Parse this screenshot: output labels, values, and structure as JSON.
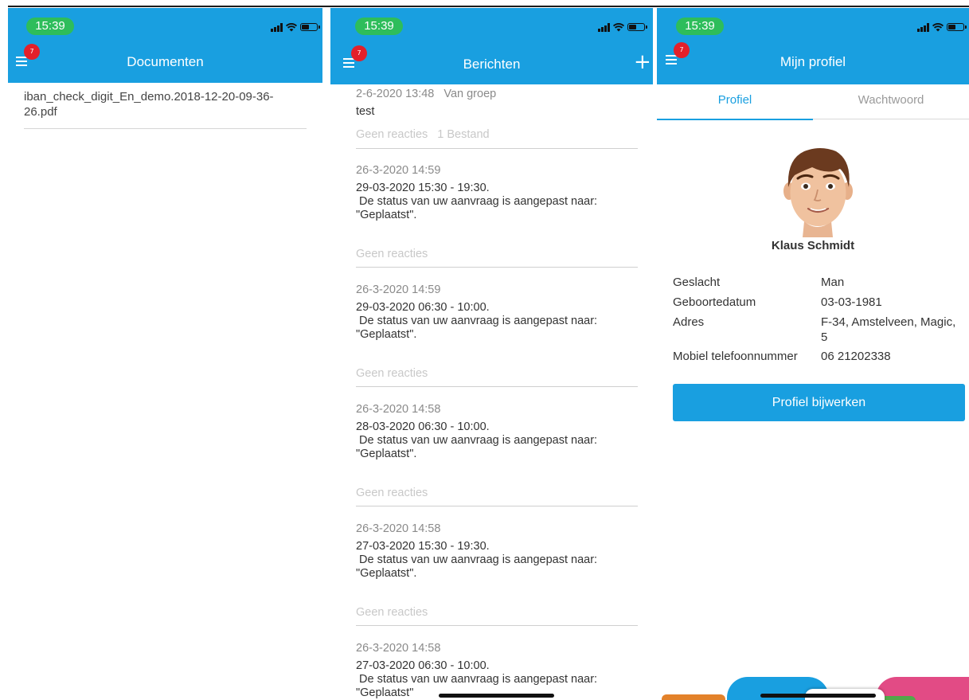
{
  "status_bar": {
    "time": "15:39"
  },
  "colors": {
    "brand_blue": "#199fe0",
    "badge_red": "#e3202a",
    "time_green": "#2ebd5b"
  },
  "icons": [
    "menu-icon",
    "plus-icon",
    "signal-icon",
    "wifi-icon",
    "battery-icon",
    "avatar-icon"
  ],
  "documents": {
    "badge": "7",
    "title": "Documenten",
    "items": [
      {
        "name": "iban_check_digit_En_demo.2018-12-20-09-36-26.pdf"
      }
    ]
  },
  "messages": {
    "badge": "7",
    "title": "Berichten",
    "plus": "+",
    "items": [
      {
        "date": "2-6-2020 13:48",
        "group": "Van groep",
        "line1": "test",
        "line2": "",
        "line3": "",
        "reactions": "Geen reacties",
        "files": "1 Bestand"
      },
      {
        "date": "26-3-2020 14:59",
        "group": "",
        "line1": "29-03-2020 15:30 - 19:30.",
        "line2": " De status van uw aanvraag is aangepast naar:",
        "line3": "\"Geplaatst\".",
        "reactions": "Geen reacties",
        "files": ""
      },
      {
        "date": "26-3-2020 14:59",
        "group": "",
        "line1": "29-03-2020 06:30 - 10:00.",
        "line2": " De status van uw aanvraag is aangepast naar:",
        "line3": "\"Geplaatst\".",
        "reactions": "Geen reacties",
        "files": ""
      },
      {
        "date": "26-3-2020 14:58",
        "group": "",
        "line1": "28-03-2020 06:30 - 10:00.",
        "line2": " De status van uw aanvraag is aangepast naar:",
        "line3": "\"Geplaatst\".",
        "reactions": "Geen reacties",
        "files": ""
      },
      {
        "date": "26-3-2020 14:58",
        "group": "",
        "line1": "27-03-2020 15:30 - 19:30.",
        "line2": " De status van uw aanvraag is aangepast naar:",
        "line3": "\"Geplaatst\".",
        "reactions": "Geen reacties",
        "files": ""
      },
      {
        "date": "26-3-2020 14:58",
        "group": "",
        "line1": "27-03-2020 06:30 - 10:00.",
        "line2": " De status van uw aanvraag is aangepast naar:",
        "line3": "\"Geplaatst\"",
        "reactions": "",
        "files": ""
      }
    ]
  },
  "profile": {
    "badge": "7",
    "title": "Mijn profiel",
    "tabs": {
      "profile": "Profiel",
      "password": "Wachtwoord"
    },
    "name": "Klaus Schmidt",
    "fields": {
      "gender": {
        "label": "Geslacht",
        "value": "Man"
      },
      "birthdate": {
        "label": "Geboortedatum",
        "value": "03-03-1981"
      },
      "address": {
        "label": "Adres",
        "value": "F-34, Amstelveen, Magic, 5"
      },
      "mobile": {
        "label": "Mobiel telefoonnummer",
        "value": "06 21202338"
      }
    },
    "update_button": "Profiel bijwerken"
  }
}
